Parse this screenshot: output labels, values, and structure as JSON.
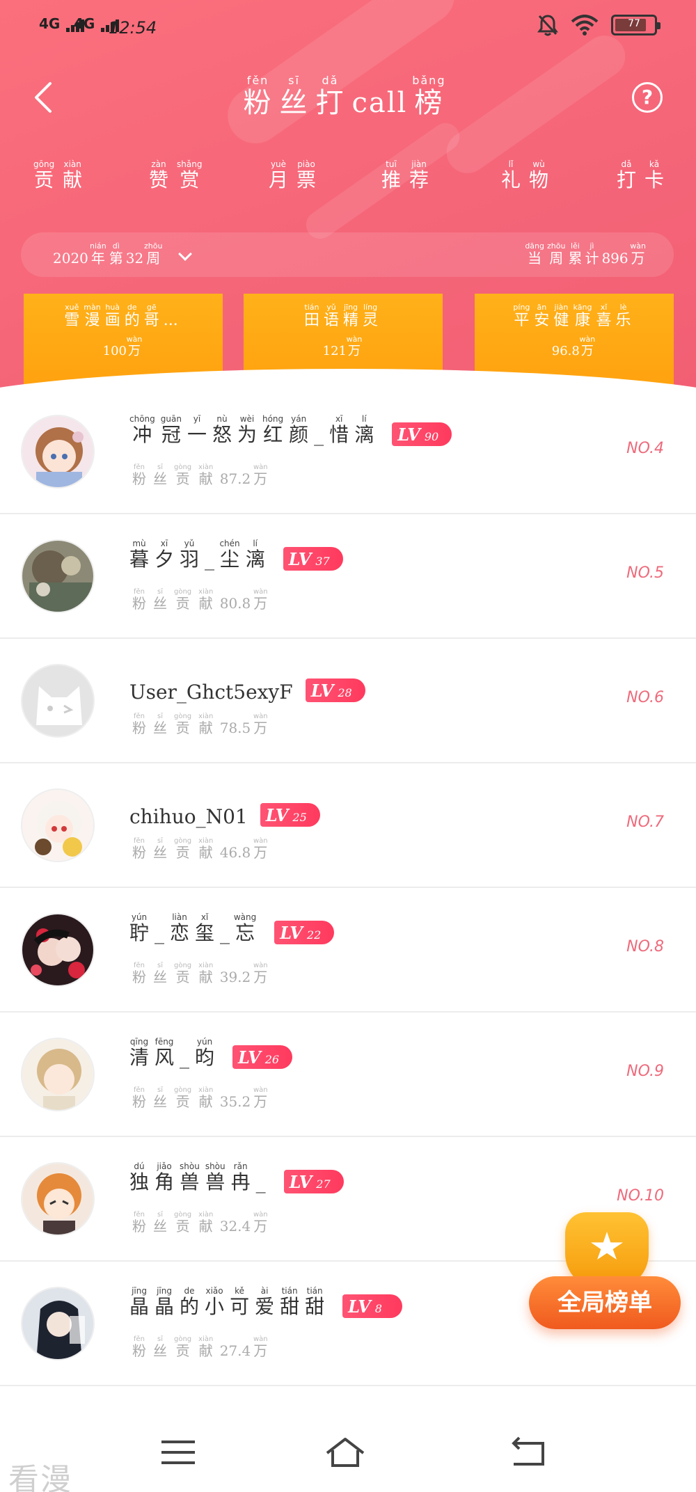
{
  "status_bar": {
    "signal_1": "4G",
    "signal_2": "4G",
    "time": "12:54",
    "battery": "77"
  },
  "header": {
    "title": [
      {
        "char": "粉",
        "pinyin": "fěn"
      },
      {
        "char": "丝",
        "pinyin": "sī"
      },
      {
        "char": "打",
        "pinyin": "dǎ"
      },
      {
        "char": "call",
        "pinyin": ""
      },
      {
        "char": "榜",
        "pinyin": "bǎng"
      }
    ]
  },
  "tabs": [
    {
      "id": "contribution",
      "chars": [
        {
          "c": "贡",
          "p": "gōng"
        },
        {
          "c": "献",
          "p": "xiàn"
        }
      ]
    },
    {
      "id": "reward",
      "chars": [
        {
          "c": "赞",
          "p": "zàn"
        },
        {
          "c": "赏",
          "p": "shǎng"
        }
      ]
    },
    {
      "id": "monthly",
      "chars": [
        {
          "c": "月",
          "p": "yuè"
        },
        {
          "c": "票",
          "p": "piào"
        }
      ]
    },
    {
      "id": "recommend",
      "chars": [
        {
          "c": "推",
          "p": "tuī"
        },
        {
          "c": "荐",
          "p": "jiàn"
        }
      ]
    },
    {
      "id": "gift",
      "chars": [
        {
          "c": "礼",
          "p": "lǐ"
        },
        {
          "c": "物",
          "p": "wù"
        }
      ]
    },
    {
      "id": "checkin",
      "chars": [
        {
          "c": "打",
          "p": "dǎ"
        },
        {
          "c": "卡",
          "p": "kǎ"
        }
      ]
    }
  ],
  "period": {
    "week_label": [
      {
        "c": "2020",
        "p": ""
      },
      {
        "c": "年",
        "p": "nián"
      },
      {
        "c": "第",
        "p": "dì"
      },
      {
        "c": "32",
        "p": ""
      },
      {
        "c": "周",
        "p": "zhōu"
      }
    ],
    "total_label": [
      {
        "c": "当",
        "p": "dāng"
      },
      {
        "c": "周",
        "p": "zhōu"
      },
      {
        "c": "累",
        "p": "lěi"
      },
      {
        "c": "计",
        "p": "jì"
      },
      {
        "c": "896",
        "p": ""
      },
      {
        "c": "万",
        "p": "wàn"
      }
    ]
  },
  "top3": [
    {
      "name": [
        {
          "c": "雪",
          "p": "xuě"
        },
        {
          "c": "漫",
          "p": "màn"
        },
        {
          "c": "画",
          "p": "huà"
        },
        {
          "c": "的",
          "p": "de"
        },
        {
          "c": "哥",
          "p": "gē"
        },
        {
          "c": "...",
          "p": ""
        }
      ],
      "value": [
        {
          "c": "100",
          "p": ""
        },
        {
          "c": "万",
          "p": "wàn"
        }
      ]
    },
    {
      "name": [
        {
          "c": "田",
          "p": "tián"
        },
        {
          "c": "语",
          "p": "yǔ"
        },
        {
          "c": "精",
          "p": "jīng"
        },
        {
          "c": "灵",
          "p": "líng"
        }
      ],
      "value": [
        {
          "c": "121",
          "p": ""
        },
        {
          "c": "万",
          "p": "wàn"
        }
      ]
    },
    {
      "name": [
        {
          "c": "平",
          "p": "píng"
        },
        {
          "c": "安",
          "p": "ān"
        },
        {
          "c": "健",
          "p": "jiàn"
        },
        {
          "c": "康",
          "p": "kāng"
        },
        {
          "c": "喜",
          "p": "xǐ"
        },
        {
          "c": "乐",
          "p": "lè"
        }
      ],
      "value": [
        {
          "c": "96.8",
          "p": ""
        },
        {
          "c": "万",
          "p": "wàn"
        }
      ]
    }
  ],
  "contrib_label": [
    {
      "c": "粉",
      "p": "fěn"
    },
    {
      "c": "丝",
      "p": "sī"
    },
    {
      "c": "贡",
      "p": "gòng"
    },
    {
      "c": "献",
      "p": "xiàn"
    }
  ],
  "wan_unit": {
    "c": "万",
    "p": "wàn"
  },
  "users": [
    {
      "name": [
        {
          "c": "冲",
          "p": "chōng"
        },
        {
          "c": "冠",
          "p": "guān"
        },
        {
          "c": "一",
          "p": "yī"
        },
        {
          "c": "怒",
          "p": "nù"
        },
        {
          "c": "为",
          "p": "wèi"
        },
        {
          "c": "红",
          "p": "hóng"
        },
        {
          "c": "颜",
          "p": "yán"
        },
        {
          "c": "_",
          "p": ""
        },
        {
          "c": "惜",
          "p": "xī"
        },
        {
          "c": "漓",
          "p": "lí"
        }
      ],
      "level": "90",
      "contribution": "87.2",
      "rank": "NO.4",
      "avatar": "anime-girl-brown-hair"
    },
    {
      "name": [
        {
          "c": "暮",
          "p": "mù"
        },
        {
          "c": "夕",
          "p": "xī"
        },
        {
          "c": "羽",
          "p": "yǔ"
        },
        {
          "c": "_",
          "p": ""
        },
        {
          "c": "尘",
          "p": "chén"
        },
        {
          "c": "漓",
          "p": "lí"
        }
      ],
      "level": "37",
      "contribution": "80.8",
      "rank": "NO.5",
      "avatar": "painting-landscape"
    },
    {
      "name": [
        {
          "c": "User_Ghct5exyF",
          "p": ""
        }
      ],
      "level": "28",
      "contribution": "78.5",
      "rank": "NO.6",
      "avatar": "default-cat"
    },
    {
      "name": [
        {
          "c": "chihuo_N01",
          "p": ""
        }
      ],
      "level": "25",
      "contribution": "46.8",
      "rank": "NO.7",
      "avatar": "chibi-white-hair"
    },
    {
      "name": [
        {
          "c": "聍",
          "p": "yún"
        },
        {
          "c": "_",
          "p": ""
        },
        {
          "c": "恋",
          "p": "liàn"
        },
        {
          "c": "玺",
          "p": "xǐ"
        },
        {
          "c": "_",
          "p": ""
        },
        {
          "c": "忘",
          "p": "wàng"
        }
      ],
      "level": "22",
      "contribution": "39.2",
      "rank": "NO.8",
      "avatar": "couple-red-flowers"
    },
    {
      "name": [
        {
          "c": "清",
          "p": "qīng"
        },
        {
          "c": "风",
          "p": "fēng"
        },
        {
          "c": "_",
          "p": ""
        },
        {
          "c": "昀",
          "p": "yún"
        }
      ],
      "level": "26",
      "contribution": "35.2",
      "rank": "NO.9",
      "avatar": "anime-boy-light-hair"
    },
    {
      "name": [
        {
          "c": "独",
          "p": "dú"
        },
        {
          "c": "角",
          "p": "jiǎo"
        },
        {
          "c": "兽",
          "p": "shòu"
        },
        {
          "c": "兽",
          "p": "shòu"
        },
        {
          "c": "冉",
          "p": "rǎn"
        },
        {
          "c": "_",
          "p": ""
        }
      ],
      "level": "27",
      "contribution": "32.4",
      "rank": "NO.10",
      "avatar": "chibi-orange-hair"
    },
    {
      "name": [
        {
          "c": "晶",
          "p": "jīng"
        },
        {
          "c": "晶",
          "p": "jīng"
        },
        {
          "c": "的",
          "p": "de"
        },
        {
          "c": "小",
          "p": "xiǎo"
        },
        {
          "c": "可",
          "p": "kě"
        },
        {
          "c": "爱",
          "p": "ài"
        },
        {
          "c": "甜",
          "p": "tián"
        },
        {
          "c": "甜",
          "p": "tián"
        }
      ],
      "level": "8",
      "contribution": "27.4",
      "rank": "",
      "avatar": "dark-hair-portrait"
    }
  ],
  "global_button": "全局榜单",
  "watermark": "看漫",
  "colors": {
    "header_pink": "#f56679",
    "podium_orange": "#ffa20f",
    "level_badge": "#ff3a5e",
    "rank_text": "#ee6a7b",
    "global_button": "#f05a1e"
  }
}
